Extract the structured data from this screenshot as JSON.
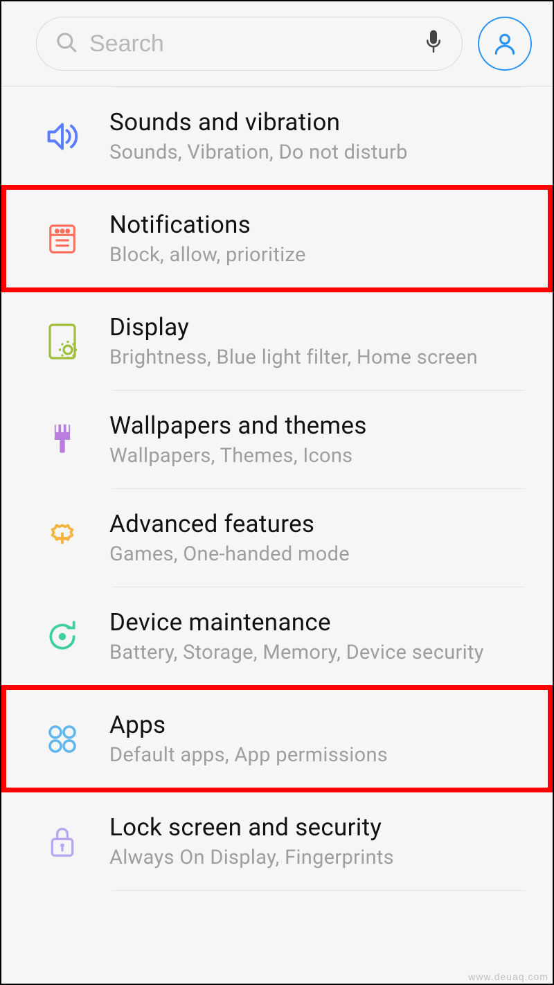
{
  "search": {
    "placeholder": "Search"
  },
  "items": [
    {
      "title": "Sounds and vibration",
      "sub": "Sounds, Vibration, Do not disturb"
    },
    {
      "title": "Notifications",
      "sub": "Block, allow, prioritize"
    },
    {
      "title": "Display",
      "sub": "Brightness, Blue light filter, Home screen"
    },
    {
      "title": "Wallpapers and themes",
      "sub": "Wallpapers, Themes, Icons"
    },
    {
      "title": "Advanced features",
      "sub": "Games, One-handed mode"
    },
    {
      "title": "Device maintenance",
      "sub": "Battery, Storage, Memory, Device security"
    },
    {
      "title": "Apps",
      "sub": "Default apps, App permissions"
    },
    {
      "title": "Lock screen and security",
      "sub": "Always On Display, Fingerprints"
    }
  ],
  "watermark": "www.deuaq.com"
}
